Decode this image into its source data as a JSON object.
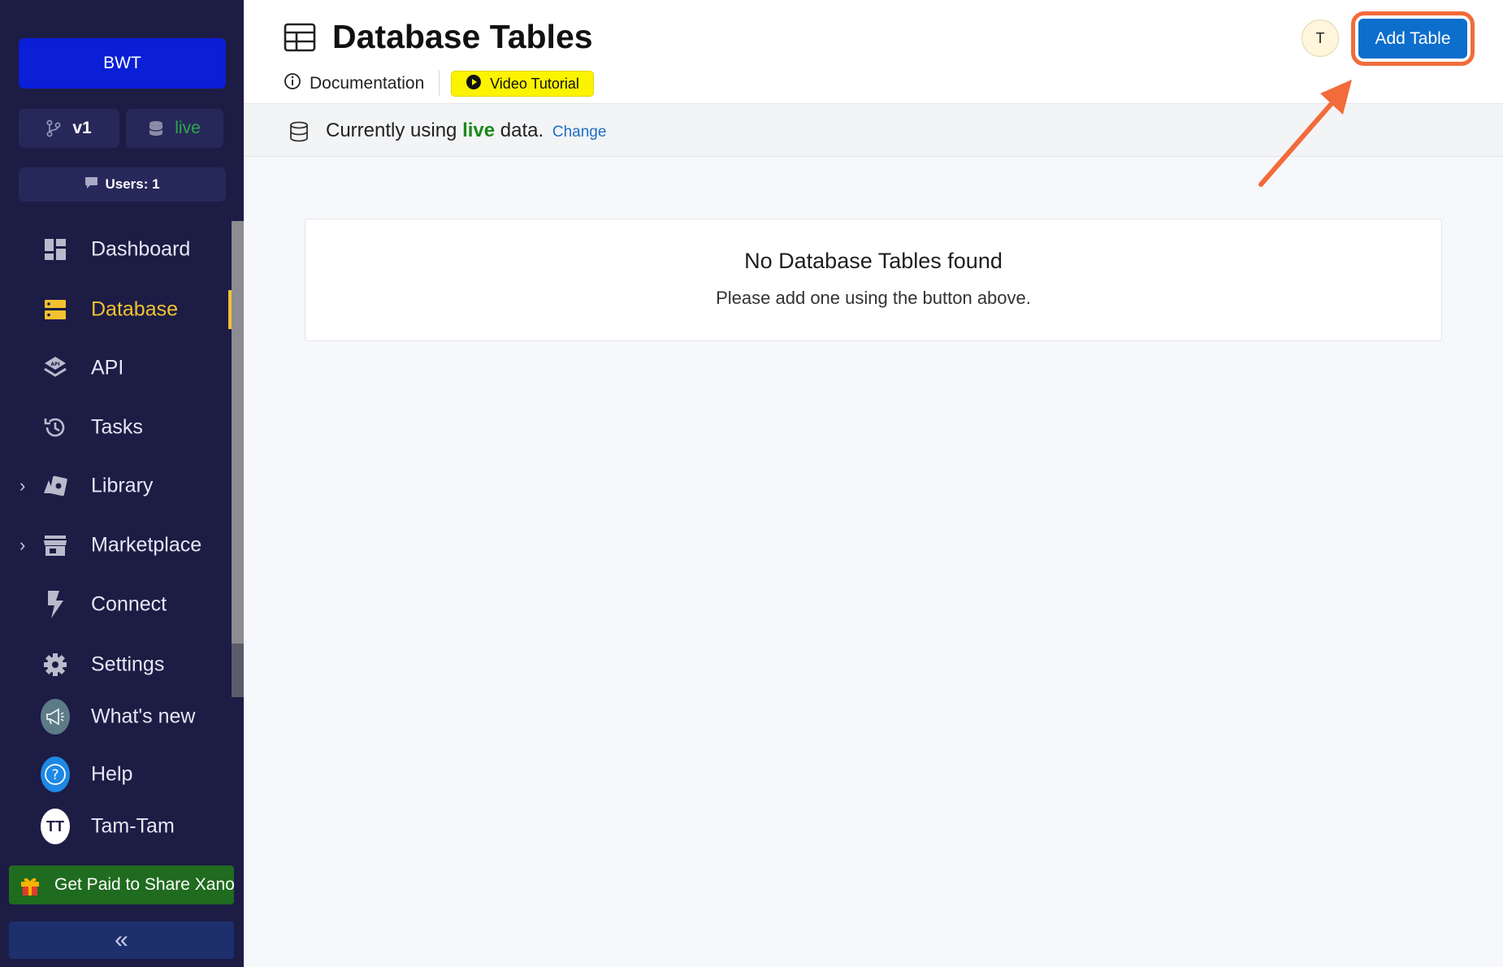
{
  "sidebar": {
    "workspace": "BWT",
    "branch": "v1",
    "environment": "live",
    "users": "Users: 1",
    "items": [
      {
        "label": "Dashboard",
        "icon": "dashboard-icon"
      },
      {
        "label": "Database",
        "icon": "database-icon",
        "active": true
      },
      {
        "label": "API",
        "icon": "api-icon"
      },
      {
        "label": "Tasks",
        "icon": "tasks-history-icon"
      },
      {
        "label": "Library",
        "icon": "library-icon",
        "expandable": true
      },
      {
        "label": "Marketplace",
        "icon": "marketplace-store-icon",
        "expandable": true
      },
      {
        "label": "Connect",
        "icon": "lightning-icon"
      },
      {
        "label": "Settings",
        "icon": "gear-icon"
      },
      {
        "label": "What's new",
        "icon": "megaphone-icon"
      },
      {
        "label": "Help",
        "icon": "help-icon"
      },
      {
        "label": "Tam-Tam",
        "icon": "user-avatar",
        "initials": "TT"
      }
    ],
    "promo": "Get Paid to Share Xano",
    "collapse_icon": "double-chevron-left-icon"
  },
  "header": {
    "title": "Database Tables",
    "documentation": "Documentation",
    "video_tutorial": "Video Tutorial",
    "avatar_initial": "T",
    "add_table": "Add Table"
  },
  "info_bar": {
    "prefix": "Currently using",
    "env": "live",
    "suffix": "data.",
    "change": "Change"
  },
  "empty_state": {
    "title": "No Database Tables found",
    "subtitle": "Please add one using the button above."
  },
  "colors": {
    "sidebar_bg": "#1c1c45",
    "workspace_btn": "#0a1fd6",
    "active_nav": "#f2c230",
    "live_green": "#1a8a1a",
    "primary_button": "#0d6ecc",
    "annotation_orange": "#f26b3a",
    "video_button": "#fbf300",
    "promo_bg": "#1f6b1f"
  }
}
